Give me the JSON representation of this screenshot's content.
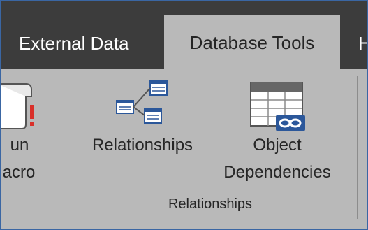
{
  "tabs": [
    {
      "label": "External Data"
    },
    {
      "label": "Database Tools"
    },
    {
      "label": "H"
    }
  ],
  "ribbon": {
    "run_macro": {
      "line1": "un",
      "line2": "acro"
    },
    "relationships": {
      "label": "Relationships"
    },
    "object_dependencies": {
      "line1": "Object",
      "line2": "Dependencies"
    },
    "group_label": "Relationships"
  },
  "colors": {
    "tab_bar": "#3c3c3c",
    "ribbon_bg": "#b9b9b9",
    "accent_blue": "#2b579a",
    "warning_red": "#d9302a"
  }
}
